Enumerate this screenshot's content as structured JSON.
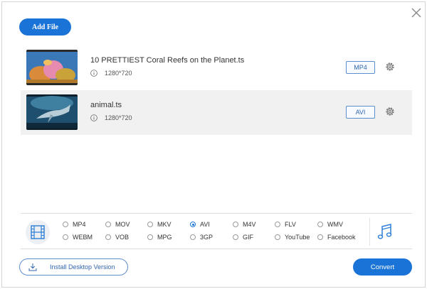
{
  "toolbar": {
    "add_file_label": "Add File"
  },
  "files": [
    {
      "name": "10 PRETTIEST Coral Reefs on the Planet.ts",
      "resolution": "1280*720",
      "format": "MP4"
    },
    {
      "name": "animal.ts",
      "resolution": "1280*720",
      "format": "AVI"
    }
  ],
  "formats": {
    "row1": [
      "MP4",
      "MOV",
      "MKV",
      "AVI",
      "M4V",
      "FLV",
      "WMV"
    ],
    "row2": [
      "WEBM",
      "VOB",
      "MPG",
      "3GP",
      "GIF",
      "YouTube",
      "Facebook"
    ],
    "selected": "AVI"
  },
  "footer": {
    "install_label": "Install Desktop Version",
    "convert_label": "Convert"
  },
  "colors": {
    "accent": "#1a73d6",
    "row_alt": "#f1f1f1",
    "border": "#5b8fd0"
  },
  "icons": [
    "close-icon",
    "info-icon",
    "gear-icon",
    "video-film-icon",
    "music-note-icon",
    "download-icon"
  ]
}
